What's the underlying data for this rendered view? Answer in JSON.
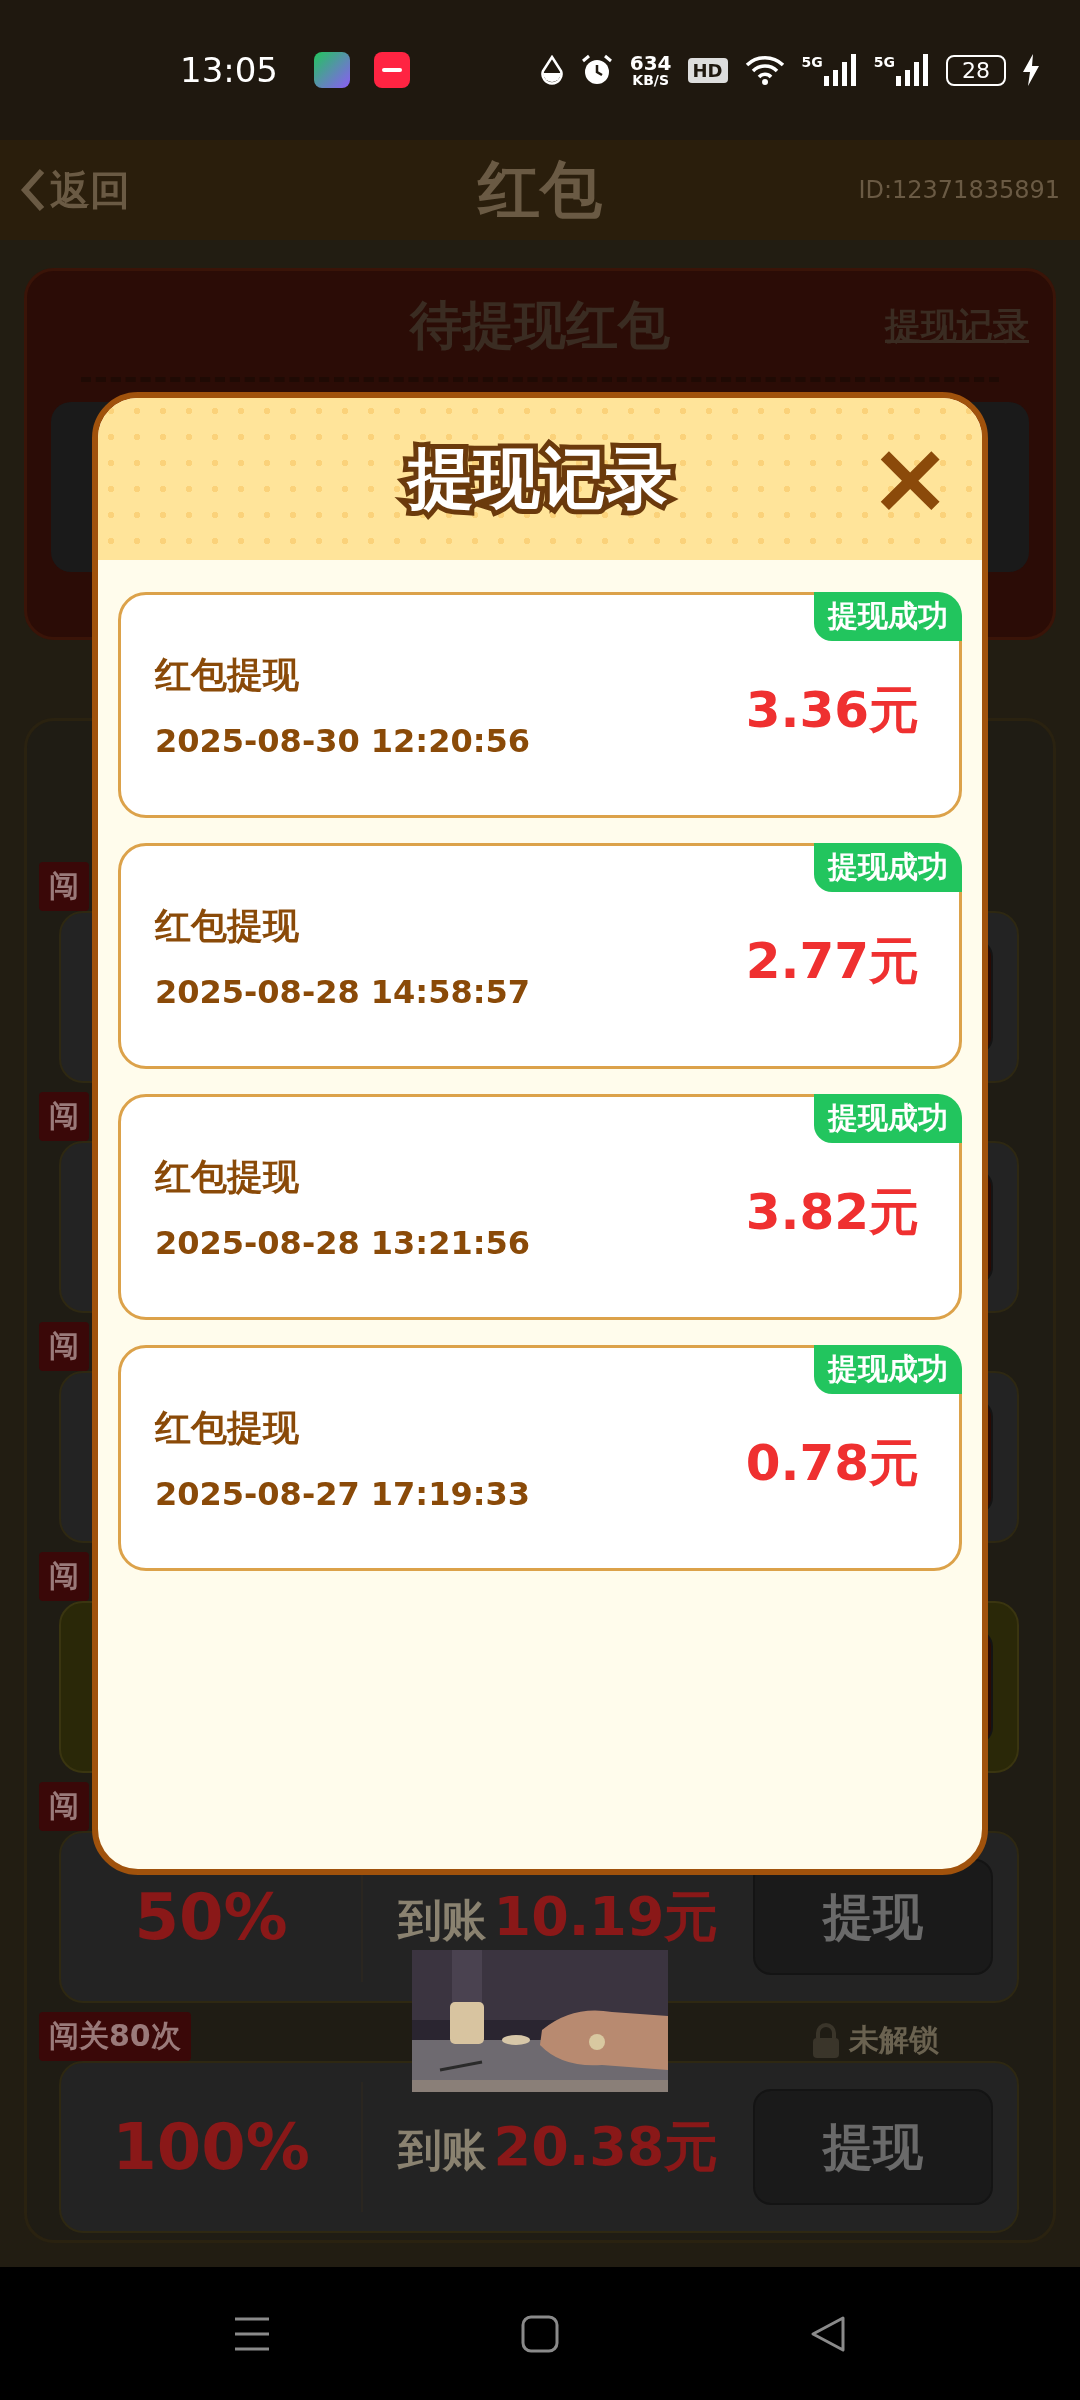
{
  "status_bar": {
    "time": "13:05",
    "speed": "634",
    "speed_unit": "KB/S",
    "hd": "HD",
    "networks": [
      "5G",
      "5G"
    ],
    "battery": "28"
  },
  "header": {
    "back": "返回",
    "title": "红包",
    "user_id": "ID:12371835891"
  },
  "pending_card": {
    "title": "待提现红包",
    "history_link": "提现记录"
  },
  "levels": [
    {
      "tag": "闯",
      "highlighted": false
    },
    {
      "tag": "闯",
      "highlighted": false
    },
    {
      "tag": "闯",
      "highlighted": false
    },
    {
      "tag": "闯",
      "highlighted": true
    },
    {
      "tag": "闯",
      "highlighted": false,
      "percent": "50%",
      "amount_label": "到账",
      "amount": "10.19元",
      "button": "提现"
    },
    {
      "tag": "闯关80次",
      "highlighted": false,
      "lock": "未解锁",
      "percent": "100%",
      "amount_label": "到账",
      "amount": "20.38元",
      "button": "提现"
    }
  ],
  "dialog": {
    "title": "提现记录",
    "close": "×",
    "records": [
      {
        "title": "红包提现",
        "time": "2025-08-30 12:20:56",
        "amount": "3.36元",
        "status": "提现成功"
      },
      {
        "title": "红包提现",
        "time": "2025-08-28 14:58:57",
        "amount": "2.77元",
        "status": "提现成功"
      },
      {
        "title": "红包提现",
        "time": "2025-08-28 13:21:56",
        "amount": "3.82元",
        "status": "提现成功"
      },
      {
        "title": "红包提现",
        "time": "2025-08-27 17:19:33",
        "amount": "0.78元",
        "status": "提现成功"
      }
    ]
  }
}
